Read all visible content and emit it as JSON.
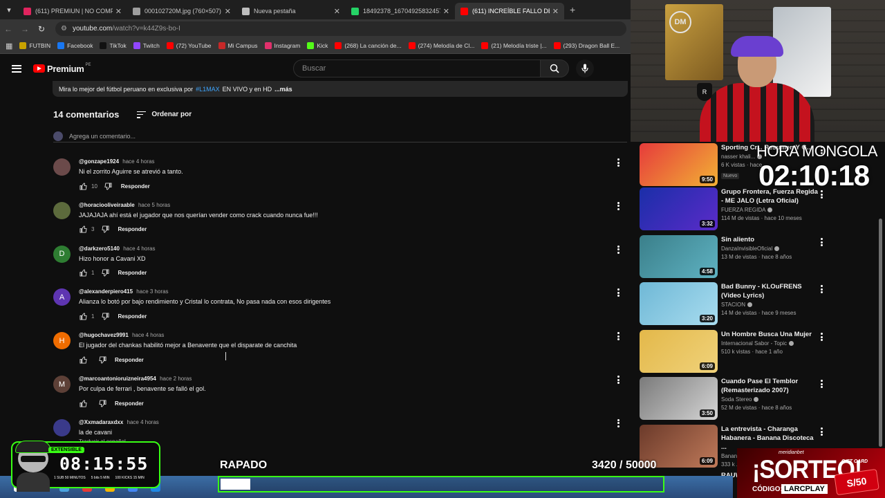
{
  "browser": {
    "tabs": [
      {
        "title": "(611) PREMIUN | NO COMPART",
        "color": "#e0245e",
        "active": false
      },
      {
        "title": "000102720M.jpg (760×507)",
        "color": "#9e9e9e",
        "active": false
      },
      {
        "title": "Nueva pestaña",
        "color": "#bdbdbd",
        "active": false
      },
      {
        "title": "18492378_1670492583245718...",
        "color": "#25d366",
        "active": false
      },
      {
        "title": "(611) INCREÍBLE FALLO DE BEN",
        "color": "#ff0000",
        "active": true
      }
    ],
    "url_host": "youtube.com",
    "url_path": "/watch?v=k44Z9s-bo-I",
    "bookmarks": [
      {
        "label": "FUTBIN",
        "color": "#c8a200"
      },
      {
        "label": "Facebook",
        "color": "#1877f2"
      },
      {
        "label": "TikTok",
        "color": "#111111"
      },
      {
        "label": "Twitch",
        "color": "#9146ff"
      },
      {
        "label": "(72) YouTube",
        "color": "#ff0000"
      },
      {
        "label": "Mi Campus",
        "color": "#c62828"
      },
      {
        "label": "Instagram",
        "color": "#e1306c"
      },
      {
        "label": "Kick",
        "color": "#53fc18"
      },
      {
        "label": "(268) La canción de...",
        "color": "#ff0000"
      },
      {
        "label": "(274) Melodía de Cl...",
        "color": "#ff0000"
      },
      {
        "label": "(21) Melodía triste |...",
        "color": "#ff0000"
      },
      {
        "label": "(293) Dragon Ball E...",
        "color": "#ff0000"
      }
    ]
  },
  "header": {
    "logo": "Premium",
    "country": "PE",
    "search_placeholder": "Buscar"
  },
  "description": {
    "text_before": "Mira lo mejor del fútbol peruano en exclusiva por",
    "hashtag": "#L1MAX",
    "text_after": "EN VIVO y en HD",
    "more": "...más"
  },
  "comments_section": {
    "count_label": "14 comentarios",
    "sort_label": "Ordenar por",
    "add_placeholder": "Agrega un comentario..."
  },
  "comments": [
    {
      "user": "@gonzape1924",
      "time": "hace 4 horas",
      "text": "Ni el zorrito Aguirre se atrevió a tanto.",
      "likes": "10",
      "avatar_letter": "",
      "avatar_color": "#6b4a4a",
      "reply": "Responder"
    },
    {
      "user": "@horaciooliveiraable",
      "time": "hace 5 horas",
      "text": "JAJAJAJA ahí está el jugador que nos querían vender como crack cuando nunca fue!!!",
      "likes": "3",
      "avatar_letter": "",
      "avatar_color": "#5c6a3c",
      "reply": "Responder"
    },
    {
      "user": "@darkzero5140",
      "time": "hace 4 horas",
      "text": "Hizo honor a Cavani XD",
      "likes": "1",
      "avatar_letter": "D",
      "avatar_color": "#2e7d32",
      "reply": "Responder"
    },
    {
      "user": "@alexanderpiero415",
      "time": "hace 3 horas",
      "text": "Alianza lo botó por bajo rendimiento y Cristal lo contrata, No pasa nada con esos dirigentes",
      "likes": "1",
      "avatar_letter": "A",
      "avatar_color": "#5e35b1",
      "reply": "Responder"
    },
    {
      "user": "@hugochavez9991",
      "time": "hace 4 horas",
      "text": "El jugador del chankas habilitó mejor a Benavente que el disparate de canchita",
      "likes": "",
      "avatar_letter": "H",
      "avatar_color": "#ef6c00",
      "reply": "Responder"
    },
    {
      "user": "@marcoantonioruizneira4954",
      "time": "hace 2 horas",
      "text": "Por culpa de ferrari , benavente se falló el gol.",
      "likes": "",
      "avatar_letter": "M",
      "avatar_color": "#5d4037",
      "reply": "Responder"
    },
    {
      "user": "@Xxmadaraxdxx",
      "time": "hace 4 horas",
      "text": "la de cavani",
      "likes": "",
      "avatar_letter": "",
      "avatar_color": "#3a3a8a",
      "reply": "",
      "translate": "Traducir al español"
    }
  ],
  "sidebar": {
    "items": [
      {
        "title": "Sporting Cr... Resumen Y G...",
        "channel": "nasser khali...",
        "stats": "6 K vistas · hace ...",
        "duration": "9:50",
        "badge": "Nuevo",
        "thumb": "linear-gradient(135deg,#e63b3b,#f2b135)"
      },
      {
        "title": "Grupo Frontera, Fuerza Regida - ME JALO (Letra Oficial)",
        "channel": "FUERZA REGIDA",
        "stats": "114 M de vistas · hace 10 meses",
        "duration": "3:32",
        "badge": "",
        "thumb": "linear-gradient(135deg,#1a2ea8,#5b2bc9)"
      },
      {
        "title": "Sin aliento",
        "channel": "DanzaInvisibleOficial",
        "stats": "13 M de vistas · hace 8 años",
        "duration": "4:58",
        "badge": "",
        "thumb": "linear-gradient(135deg,#3a7f8a,#5fb2c2)"
      },
      {
        "title": "Bad Bunny - KLOuFRENS (Video Lyrics)",
        "channel": "STACION",
        "stats": "14 M de vistas · hace 9 meses",
        "duration": "3:20",
        "badge": "",
        "thumb": "linear-gradient(135deg,#6fb8d6,#a8dcef)"
      },
      {
        "title": "Un Hombre Busca Una Mujer",
        "channel": "Internacional Sabor - Topic",
        "stats": "510 k vistas · hace 1 año",
        "duration": "6:09",
        "badge": "",
        "thumb": "linear-gradient(135deg,#e3b84a,#f0d27a)"
      },
      {
        "title": "Cuando Pase El Temblor (Remasterizado 2007)",
        "channel": "Soda Stereo",
        "stats": "52 M de vistas · hace 8 años",
        "duration": "3:50",
        "badge": "",
        "thumb": "linear-gradient(135deg,#7a7a7a,#d5d5d5)"
      },
      {
        "title": "La entrevista - Charanga Habanera - Banana Discoteca ...",
        "channel": "Banana Discoteca",
        "stats": "333 k ...",
        "duration": "6:09",
        "badge": "",
        "thumb": "linear-gradient(135deg,#6b3a2a,#c07a5a)"
      }
    ],
    "last_partial": "RAUW..."
  },
  "overlays": {
    "hora_label": "HORA MONGOLA",
    "hora_time": "02:10:18",
    "timer_badge": "EXTENSIBLE",
    "timer": "08:15:55",
    "timer_legend": [
      "1 SUB 50 MINUTOS",
      "5 bits 5 MIN",
      "100 KICKS 15 MIN"
    ],
    "goal_label": "RAPADO",
    "goal_current": "3420",
    "goal_target": "/ 50000",
    "goal_fraction": 0.0684,
    "sorteo_brand": "meridianbet",
    "sorteo_big": "¡SORTEO!",
    "code_label": "CÓDIGO:",
    "code_value": "LARCPLAY",
    "gift_label": "GIFT CARD",
    "gift_price": "S/50"
  },
  "webcam": {
    "crest_letter": "R",
    "logo_letters": "DM"
  }
}
